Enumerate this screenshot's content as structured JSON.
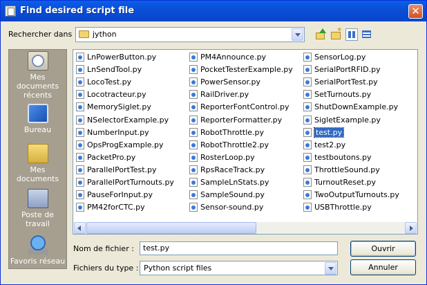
{
  "window": {
    "title": "Find desired script file",
    "close_label": "✕"
  },
  "lookin": {
    "label": "Rechercher dans :",
    "value": "jython"
  },
  "toolbar": {
    "icons": [
      "up-folder-icon",
      "new-folder-icon",
      "list-view-icon",
      "details-view-icon"
    ]
  },
  "places": [
    {
      "label": "Mes documents récents",
      "icon": "recent-documents-icon"
    },
    {
      "label": "Bureau",
      "icon": "desktop-icon"
    },
    {
      "label": "Mes documents",
      "icon": "my-documents-icon"
    },
    {
      "label": "Poste de travail",
      "icon": "computer-icon"
    },
    {
      "label": "Favoris réseau",
      "icon": "network-icon"
    }
  ],
  "files": {
    "columns": [
      [
        "LnPowerButton.py",
        "LnSendTool.py",
        "LocoTest.py",
        "Locotracteur.py",
        "MemorySiglet.py",
        "NSelectorExample.py",
        "NumberInput.py",
        "OpsProgExample.py",
        "PacketPro.py",
        "ParallelPortTest.py",
        "ParallelPortTurnouts.py",
        "PauseForInput.py",
        "PM42forCTC.py"
      ],
      [
        "PM4Announce.py",
        "PocketTesterExample.py",
        "PowerSensor.py",
        "RailDriver.py",
        "ReporterFontControl.py",
        "ReporterFormatter.py",
        "RobotThrottle.py",
        "RobotThrottle2.py",
        "RosterLoop.py",
        "RpsRaceTrack.py",
        "SampleLnStats.py",
        "SampleSound.py",
        "Sensor-sound.py"
      ],
      [
        "SensorLog.py",
        "SerialPortRFID.py",
        "SerialPortTest.py",
        "SetTurnouts.py",
        "ShutDownExample.py",
        "SigletExample.py",
        "test.py",
        "test2.py",
        "testboutons.py",
        "ThrottleSound.py",
        "TurnoutReset.py",
        "TwoOutputTurnouts.py",
        "USBThrottle.py"
      ]
    ],
    "selected": "test.py"
  },
  "filename": {
    "label": "Nom de fichier :",
    "value": "test.py"
  },
  "filetype": {
    "label": "Fichiers du type :",
    "value": "Python script files"
  },
  "buttons": {
    "open": "Ouvrir",
    "cancel": "Annuler"
  }
}
